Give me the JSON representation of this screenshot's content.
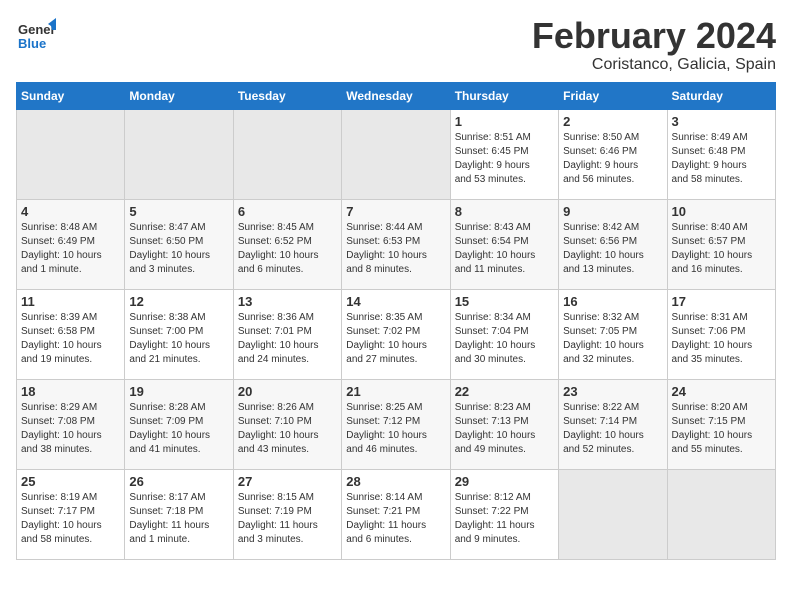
{
  "header": {
    "logo_general": "General",
    "logo_blue": "Blue",
    "month_title": "February 2024",
    "location": "Coristanco, Galicia, Spain"
  },
  "calendar": {
    "days_of_week": [
      "Sunday",
      "Monday",
      "Tuesday",
      "Wednesday",
      "Thursday",
      "Friday",
      "Saturday"
    ],
    "weeks": [
      [
        {
          "day": "",
          "info": ""
        },
        {
          "day": "",
          "info": ""
        },
        {
          "day": "",
          "info": ""
        },
        {
          "day": "",
          "info": ""
        },
        {
          "day": "1",
          "info": "Sunrise: 8:51 AM\nSunset: 6:45 PM\nDaylight: 9 hours\nand 53 minutes."
        },
        {
          "day": "2",
          "info": "Sunrise: 8:50 AM\nSunset: 6:46 PM\nDaylight: 9 hours\nand 56 minutes."
        },
        {
          "day": "3",
          "info": "Sunrise: 8:49 AM\nSunset: 6:48 PM\nDaylight: 9 hours\nand 58 minutes."
        }
      ],
      [
        {
          "day": "4",
          "info": "Sunrise: 8:48 AM\nSunset: 6:49 PM\nDaylight: 10 hours\nand 1 minute."
        },
        {
          "day": "5",
          "info": "Sunrise: 8:47 AM\nSunset: 6:50 PM\nDaylight: 10 hours\nand 3 minutes."
        },
        {
          "day": "6",
          "info": "Sunrise: 8:45 AM\nSunset: 6:52 PM\nDaylight: 10 hours\nand 6 minutes."
        },
        {
          "day": "7",
          "info": "Sunrise: 8:44 AM\nSunset: 6:53 PM\nDaylight: 10 hours\nand 8 minutes."
        },
        {
          "day": "8",
          "info": "Sunrise: 8:43 AM\nSunset: 6:54 PM\nDaylight: 10 hours\nand 11 minutes."
        },
        {
          "day": "9",
          "info": "Sunrise: 8:42 AM\nSunset: 6:56 PM\nDaylight: 10 hours\nand 13 minutes."
        },
        {
          "day": "10",
          "info": "Sunrise: 8:40 AM\nSunset: 6:57 PM\nDaylight: 10 hours\nand 16 minutes."
        }
      ],
      [
        {
          "day": "11",
          "info": "Sunrise: 8:39 AM\nSunset: 6:58 PM\nDaylight: 10 hours\nand 19 minutes."
        },
        {
          "day": "12",
          "info": "Sunrise: 8:38 AM\nSunset: 7:00 PM\nDaylight: 10 hours\nand 21 minutes."
        },
        {
          "day": "13",
          "info": "Sunrise: 8:36 AM\nSunset: 7:01 PM\nDaylight: 10 hours\nand 24 minutes."
        },
        {
          "day": "14",
          "info": "Sunrise: 8:35 AM\nSunset: 7:02 PM\nDaylight: 10 hours\nand 27 minutes."
        },
        {
          "day": "15",
          "info": "Sunrise: 8:34 AM\nSunset: 7:04 PM\nDaylight: 10 hours\nand 30 minutes."
        },
        {
          "day": "16",
          "info": "Sunrise: 8:32 AM\nSunset: 7:05 PM\nDaylight: 10 hours\nand 32 minutes."
        },
        {
          "day": "17",
          "info": "Sunrise: 8:31 AM\nSunset: 7:06 PM\nDaylight: 10 hours\nand 35 minutes."
        }
      ],
      [
        {
          "day": "18",
          "info": "Sunrise: 8:29 AM\nSunset: 7:08 PM\nDaylight: 10 hours\nand 38 minutes."
        },
        {
          "day": "19",
          "info": "Sunrise: 8:28 AM\nSunset: 7:09 PM\nDaylight: 10 hours\nand 41 minutes."
        },
        {
          "day": "20",
          "info": "Sunrise: 8:26 AM\nSunset: 7:10 PM\nDaylight: 10 hours\nand 43 minutes."
        },
        {
          "day": "21",
          "info": "Sunrise: 8:25 AM\nSunset: 7:12 PM\nDaylight: 10 hours\nand 46 minutes."
        },
        {
          "day": "22",
          "info": "Sunrise: 8:23 AM\nSunset: 7:13 PM\nDaylight: 10 hours\nand 49 minutes."
        },
        {
          "day": "23",
          "info": "Sunrise: 8:22 AM\nSunset: 7:14 PM\nDaylight: 10 hours\nand 52 minutes."
        },
        {
          "day": "24",
          "info": "Sunrise: 8:20 AM\nSunset: 7:15 PM\nDaylight: 10 hours\nand 55 minutes."
        }
      ],
      [
        {
          "day": "25",
          "info": "Sunrise: 8:19 AM\nSunset: 7:17 PM\nDaylight: 10 hours\nand 58 minutes."
        },
        {
          "day": "26",
          "info": "Sunrise: 8:17 AM\nSunset: 7:18 PM\nDaylight: 11 hours\nand 1 minute."
        },
        {
          "day": "27",
          "info": "Sunrise: 8:15 AM\nSunset: 7:19 PM\nDaylight: 11 hours\nand 3 minutes."
        },
        {
          "day": "28",
          "info": "Sunrise: 8:14 AM\nSunset: 7:21 PM\nDaylight: 11 hours\nand 6 minutes."
        },
        {
          "day": "29",
          "info": "Sunrise: 8:12 AM\nSunset: 7:22 PM\nDaylight: 11 hours\nand 9 minutes."
        },
        {
          "day": "",
          "info": ""
        },
        {
          "day": "",
          "info": ""
        }
      ]
    ]
  }
}
